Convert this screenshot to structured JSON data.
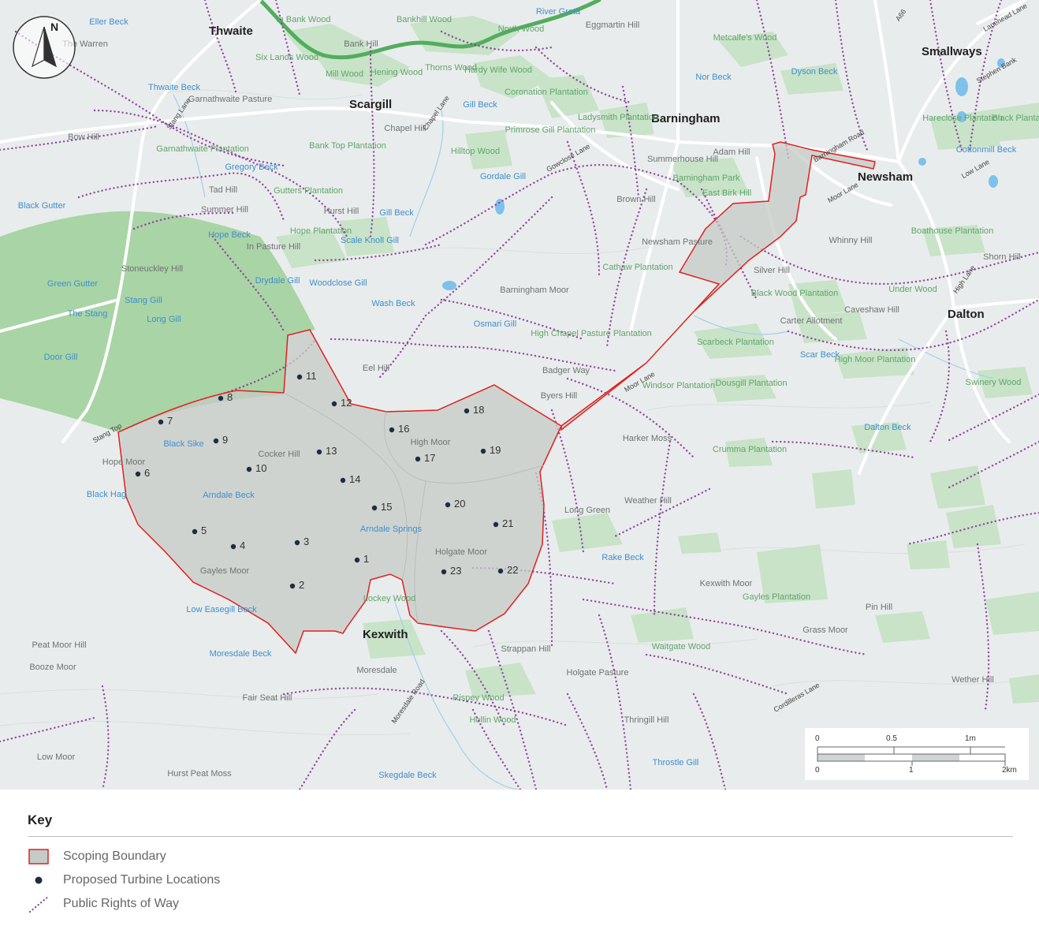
{
  "colors": {
    "land": "#e9ecec",
    "woodland": "#c8e3c8",
    "moor_forest": "#a9d4a5",
    "water": "#7ec1ea",
    "river": "#52ad5e",
    "boundary": "#e02020",
    "boundary_fill": "#c6cbc7",
    "turbine": "#1f2d40",
    "row_path": "#8a3a9c",
    "roads": "#ffffff"
  },
  "compass": {
    "north_label": "N"
  },
  "places": [
    {
      "name": "Thwaite",
      "kind": "town"
    },
    {
      "name": "Scargill",
      "kind": "town"
    },
    {
      "name": "Barningham",
      "kind": "town"
    },
    {
      "name": "Smallways",
      "kind": "town"
    },
    {
      "name": "Newsham",
      "kind": "town"
    },
    {
      "name": "Dalton",
      "kind": "town"
    },
    {
      "name": "Kexwith",
      "kind": "town"
    },
    {
      "name": "Eller Beck",
      "kind": "water"
    },
    {
      "name": "The Warren",
      "kind": "place"
    },
    {
      "name": "In Bank Wood",
      "kind": "wood"
    },
    {
      "name": "Bank Hill",
      "kind": "place"
    },
    {
      "name": "Bankhill Wood",
      "kind": "wood"
    },
    {
      "name": "River Greta",
      "kind": "water"
    },
    {
      "name": "North Wood",
      "kind": "wood"
    },
    {
      "name": "Eggmartin Hill",
      "kind": "place"
    },
    {
      "name": "Metcalfe's Wood",
      "kind": "wood"
    },
    {
      "name": "A66",
      "kind": "road"
    },
    {
      "name": "Lanehead Lane",
      "kind": "road"
    },
    {
      "name": "Six Lands Wood",
      "kind": "wood"
    },
    {
      "name": "Mill Wood",
      "kind": "wood"
    },
    {
      "name": "Hening Wood",
      "kind": "wood"
    },
    {
      "name": "Thorns Wood",
      "kind": "wood"
    },
    {
      "name": "Hardy Wife Wood",
      "kind": "wood"
    },
    {
      "name": "Nor Beck",
      "kind": "water"
    },
    {
      "name": "Dyson Beck",
      "kind": "water"
    },
    {
      "name": "Stephen Bank",
      "kind": "road"
    },
    {
      "name": "Thwaite Beck",
      "kind": "water"
    },
    {
      "name": "Garnathwaite Pasture",
      "kind": "place"
    },
    {
      "name": "Chapel Lane",
      "kind": "road"
    },
    {
      "name": "Gill Beck",
      "kind": "water"
    },
    {
      "name": "Coronation Plantation",
      "kind": "wood"
    },
    {
      "name": "Ladysmith Plantation",
      "kind": "wood"
    },
    {
      "name": "Hareclose Plantation",
      "kind": "wood"
    },
    {
      "name": "Black Plantation",
      "kind": "wood"
    },
    {
      "name": "Stang Lane",
      "kind": "road"
    },
    {
      "name": "Chapel Hill",
      "kind": "place"
    },
    {
      "name": "Primrose Gill Plantation",
      "kind": "wood"
    },
    {
      "name": "Barningham Road",
      "kind": "road"
    },
    {
      "name": "Cottonmill Beck",
      "kind": "water"
    },
    {
      "name": "Bow Hill",
      "kind": "place"
    },
    {
      "name": "Garnathwaite Plantation",
      "kind": "wood"
    },
    {
      "name": "Bank Top Plantation",
      "kind": "wood"
    },
    {
      "name": "Hilltop Wood",
      "kind": "wood"
    },
    {
      "name": "Gowclose Lane",
      "kind": "road"
    },
    {
      "name": "Summerhouse Hill",
      "kind": "place"
    },
    {
      "name": "Adam Hill",
      "kind": "place"
    },
    {
      "name": "Barningham Park",
      "kind": "wood"
    },
    {
      "name": "Gregory Beck",
      "kind": "water"
    },
    {
      "name": "Gordale Gill",
      "kind": "water"
    },
    {
      "name": "Low Lane",
      "kind": "road"
    },
    {
      "name": "Tad Hill",
      "kind": "place"
    },
    {
      "name": "Gutters Plantation",
      "kind": "wood"
    },
    {
      "name": "East Birk Hill",
      "kind": "wood"
    },
    {
      "name": "Moor Lane",
      "kind": "road"
    },
    {
      "name": "Brown Hill",
      "kind": "place"
    },
    {
      "name": "Black Gutter",
      "kind": "water"
    },
    {
      "name": "Summer Hill",
      "kind": "place"
    },
    {
      "name": "Hurst Hill",
      "kind": "place"
    },
    {
      "name": "Gill Beck",
      "kind": "water"
    },
    {
      "name": "Hope Beck",
      "kind": "water"
    },
    {
      "name": "Hope Plantation",
      "kind": "wood"
    },
    {
      "name": "Boathouse Plantation",
      "kind": "wood"
    },
    {
      "name": "Whinny Hill",
      "kind": "place"
    },
    {
      "name": "In Pasture Hill",
      "kind": "place"
    },
    {
      "name": "Scale Knoll Gill",
      "kind": "water"
    },
    {
      "name": "Newsham Pasture",
      "kind": "place"
    },
    {
      "name": "Shorn Hill",
      "kind": "place"
    },
    {
      "name": "Stoneuckley Hill",
      "kind": "place"
    },
    {
      "name": "Cathaw Plantation",
      "kind": "wood"
    },
    {
      "name": "Silver Hill",
      "kind": "place"
    },
    {
      "name": "High Lane",
      "kind": "road"
    },
    {
      "name": "Green Gutter",
      "kind": "water"
    },
    {
      "name": "Drydale Gill",
      "kind": "water"
    },
    {
      "name": "Woodclose Gill",
      "kind": "water"
    },
    {
      "name": "Barningham Moor",
      "kind": "place"
    },
    {
      "name": "Black Wood Plantation",
      "kind": "wood"
    },
    {
      "name": "Under Wood",
      "kind": "wood"
    },
    {
      "name": "Stang Gill",
      "kind": "water"
    },
    {
      "name": "Wash Beck",
      "kind": "water"
    },
    {
      "name": "Caveshaw Hill",
      "kind": "place"
    },
    {
      "name": "The Stang",
      "kind": "water"
    },
    {
      "name": "Long Gill",
      "kind": "water"
    },
    {
      "name": "Osmari Gill",
      "kind": "water"
    },
    {
      "name": "High Chapel Pasture Plantation",
      "kind": "wood"
    },
    {
      "name": "Carter Allotment",
      "kind": "place"
    },
    {
      "name": "Scarbeck Plantation",
      "kind": "wood"
    },
    {
      "name": "Scar Beck",
      "kind": "water"
    },
    {
      "name": "Door Gill",
      "kind": "water"
    },
    {
      "name": "High Moor Plantation",
      "kind": "wood"
    },
    {
      "name": "Eel Hill",
      "kind": "place"
    },
    {
      "name": "Badger Way",
      "kind": "place"
    },
    {
      "name": "Moor Lane",
      "kind": "road"
    },
    {
      "name": "Swinery Wood",
      "kind": "wood"
    },
    {
      "name": "Byers Hill",
      "kind": "place"
    },
    {
      "name": "Windsor Plantation",
      "kind": "wood"
    },
    {
      "name": "Dousgill Plantation",
      "kind": "wood"
    },
    {
      "name": "Black Sike",
      "kind": "water"
    },
    {
      "name": "Cocker Hill",
      "kind": "place"
    },
    {
      "name": "High Moor",
      "kind": "place"
    },
    {
      "name": "Harker Moss",
      "kind": "place"
    },
    {
      "name": "Dalton Beck",
      "kind": "water"
    },
    {
      "name": "Stang Top",
      "kind": "road"
    },
    {
      "name": "Hope Moor",
      "kind": "place"
    },
    {
      "name": "Crumma Plantation",
      "kind": "wood"
    },
    {
      "name": "Black Hag",
      "kind": "water"
    },
    {
      "name": "Arndale Beck",
      "kind": "water"
    },
    {
      "name": "Weather Hill",
      "kind": "place"
    },
    {
      "name": "Long Green",
      "kind": "place"
    },
    {
      "name": "Arndale Springs",
      "kind": "water"
    },
    {
      "name": "Holgate Moor",
      "kind": "place"
    },
    {
      "name": "Rake Beck",
      "kind": "water"
    },
    {
      "name": "Kexwith Moor",
      "kind": "place"
    },
    {
      "name": "Gayles Moor",
      "kind": "place"
    },
    {
      "name": "Gayles Plantation",
      "kind": "wood"
    },
    {
      "name": "Lockey Wood",
      "kind": "wood"
    },
    {
      "name": "Low Easegill Beck",
      "kind": "water"
    },
    {
      "name": "Pin Hill",
      "kind": "place"
    },
    {
      "name": "Grass Moor",
      "kind": "place"
    },
    {
      "name": "Peat Moor Hill",
      "kind": "place"
    },
    {
      "name": "Waitgate Wood",
      "kind": "wood"
    },
    {
      "name": "Strappan Hill",
      "kind": "place"
    },
    {
      "name": "Moresdale Beck",
      "kind": "water"
    },
    {
      "name": "Booze Moor",
      "kind": "place"
    },
    {
      "name": "Moresdale",
      "kind": "place"
    },
    {
      "name": "Holgate Pasture",
      "kind": "place"
    },
    {
      "name": "Wether Hill",
      "kind": "place"
    },
    {
      "name": "Fair Seat Hill",
      "kind": "place"
    },
    {
      "name": "Rispey Wood",
      "kind": "wood"
    },
    {
      "name": "Moresdale Road",
      "kind": "road"
    },
    {
      "name": "Hollin Wood",
      "kind": "wood"
    },
    {
      "name": "Thringill Hill",
      "kind": "place"
    },
    {
      "name": "Cordilleras Lane",
      "kind": "road"
    },
    {
      "name": "Low Moor",
      "kind": "place"
    },
    {
      "name": "Throstle Gill",
      "kind": "water"
    },
    {
      "name": "Hurst Peat Moss",
      "kind": "place"
    },
    {
      "name": "Skegdale Beck",
      "kind": "water"
    }
  ],
  "turbines": [
    "1",
    "2",
    "3",
    "4",
    "5",
    "6",
    "7",
    "8",
    "9",
    "10",
    "11",
    "12",
    "13",
    "14",
    "15",
    "16",
    "17",
    "18",
    "19",
    "20",
    "21",
    "22",
    "23"
  ],
  "scale_bar": {
    "miles_ticks": [
      "0",
      "0.5",
      "1m"
    ],
    "km_ticks": [
      "0",
      "1",
      "2km"
    ]
  },
  "key": {
    "title": "Key",
    "items": [
      {
        "id": "boundary",
        "label": "Scoping Boundary"
      },
      {
        "id": "turbine",
        "label": "Proposed Turbine Locations"
      },
      {
        "id": "row",
        "label": "Public Rights of Way"
      }
    ]
  }
}
